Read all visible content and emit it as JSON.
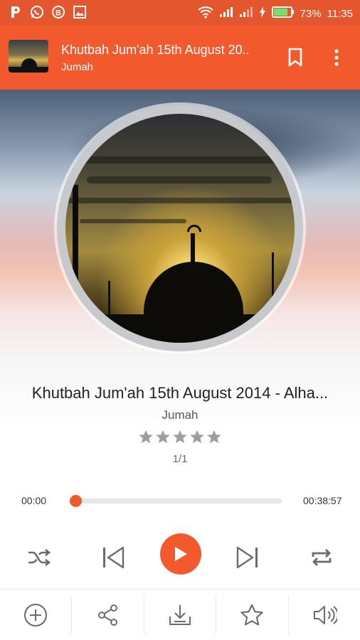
{
  "status_bar": {
    "battery_percent": "73%",
    "time": "11:35",
    "notification_icons": [
      "p-app-icon",
      "whatsapp-icon",
      "b-app-icon",
      "image-icon"
    ]
  },
  "app_bar": {
    "title": "Khutbah Jum'ah 15th August 20..",
    "subtitle": "Jumah"
  },
  "player": {
    "track_title": "Khutbah Jum'ah 15th August 2014 - Alha...",
    "album": "Jumah",
    "rating": 0,
    "rating_max": 5,
    "queue_position": "1/1",
    "elapsed": "00:00",
    "duration": "00:38:57",
    "progress": 0.0
  },
  "controls": [
    "shuffle-icon",
    "previous-icon",
    "play-icon",
    "next-icon",
    "repeat-icon"
  ],
  "bottom_actions": [
    "add-to-playlist-icon",
    "share-icon",
    "download-icon",
    "favorite-star-icon",
    "volume-icon"
  ],
  "colors": {
    "accent": "#f25a2e",
    "status_bar": "#e4562d",
    "icon_gray": "#6b6b6b",
    "star_gray": "#9e9e9e"
  }
}
